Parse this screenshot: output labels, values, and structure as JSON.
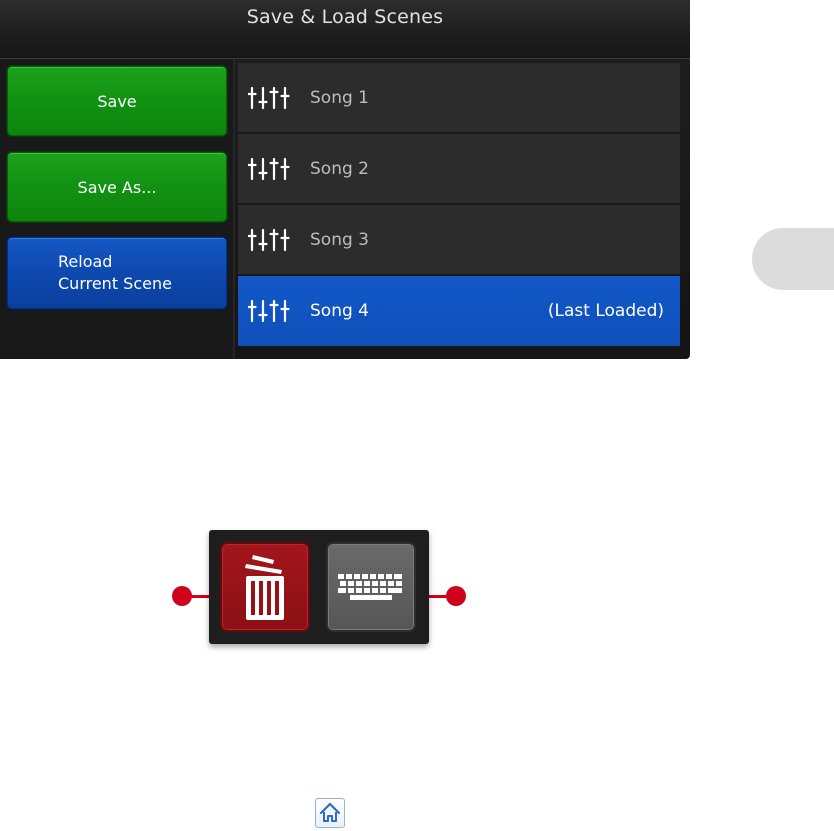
{
  "header": {
    "title": "Save & Load Scenes"
  },
  "actions": {
    "save_label": "Save",
    "save_as_label": "Save As...",
    "reload_line1": "Reload",
    "reload_line2": "Current Scene"
  },
  "scenes": [
    {
      "name": "Song 1",
      "status": "",
      "icon": "mixer-faders-icon"
    },
    {
      "name": "Song 2",
      "status": "",
      "icon": "mixer-faders-icon"
    },
    {
      "name": "Song 3",
      "status": "",
      "icon": "mixer-faders-icon"
    },
    {
      "name": "Song 4",
      "status": "(Last Loaded)",
      "icon": "mixer-faders-icon",
      "selected": true
    }
  ],
  "tools": [
    {
      "icon": "trash-icon",
      "color": "#9b1418"
    },
    {
      "icon": "keyboard-icon",
      "color": "#5f5f5f"
    }
  ],
  "colors": {
    "panel_bg": "#1b1b1b",
    "save_green": "#129112",
    "reload_blue": "#0e49b0",
    "selected_blue": "#1258c9",
    "callout_red": "#d0021b"
  }
}
